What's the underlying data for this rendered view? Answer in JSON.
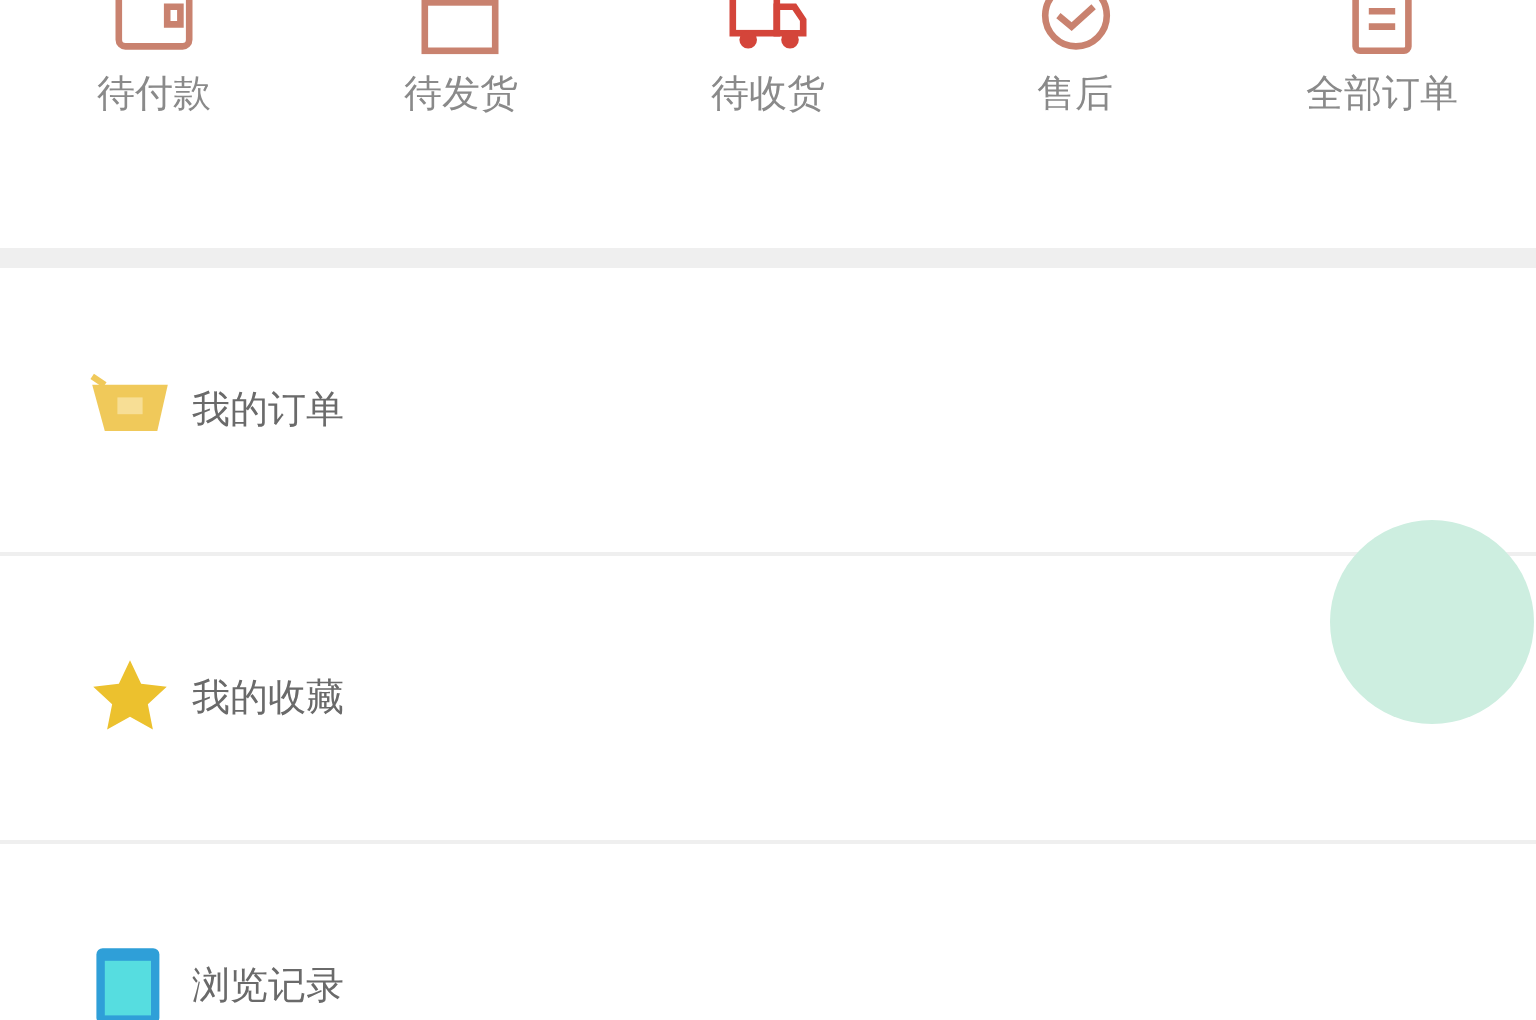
{
  "order_status": [
    {
      "kind": "wallet",
      "label": "待付款"
    },
    {
      "kind": "box",
      "label": "待发货"
    },
    {
      "kind": "truck",
      "label": "待收货"
    },
    {
      "kind": "service",
      "label": "售后"
    },
    {
      "kind": "list",
      "label": "全部订单"
    }
  ],
  "menu": [
    {
      "kind": "basket",
      "label": "我的订单"
    },
    {
      "kind": "star",
      "label": "我的收藏"
    },
    {
      "kind": "history",
      "label": "浏览记录"
    }
  ]
}
